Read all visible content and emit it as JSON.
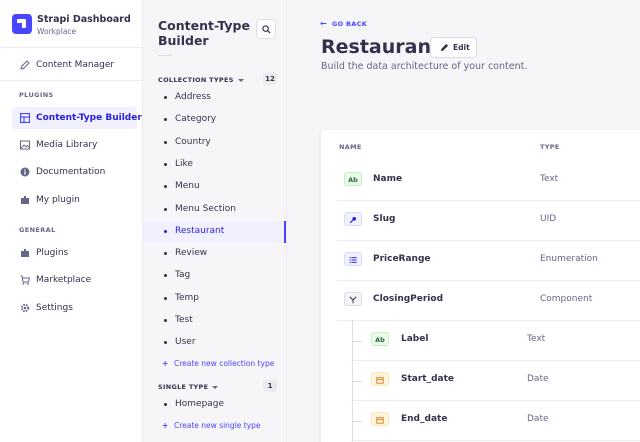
{
  "brand": {
    "title": "Strapi Dashboard",
    "subtitle": "Workplace"
  },
  "mainnav": {
    "content_manager": "Content Manager",
    "plugins_heading": "PLUGINS",
    "plugins": [
      {
        "label": "Content-Type Builder",
        "active": true
      },
      {
        "label": "Media Library"
      },
      {
        "label": "Documentation"
      },
      {
        "label": "My plugin"
      }
    ],
    "general_heading": "GENERAL",
    "general": [
      {
        "label": "Plugins"
      },
      {
        "label": "Marketplace"
      },
      {
        "label": "Settings"
      }
    ]
  },
  "subnav": {
    "title": "Content-Type Builder",
    "collection_heading": "COLLECTION TYPES",
    "collection_count": "12",
    "collection_types": [
      "Address",
      "Category",
      "Country",
      "Like",
      "Menu",
      "Menu Section",
      "Restaurant",
      "Review",
      "Tag",
      "Temp",
      "Test",
      "User"
    ],
    "active_collection": "Restaurant",
    "create_collection": "Create new collection type",
    "single_heading": "SINGLE TYPE",
    "single_count": "1",
    "single_types": [
      "Homepage"
    ],
    "create_single": "Create new single type"
  },
  "main": {
    "go_back": "GO BACK",
    "title": "Restaurant",
    "edit_label": "Edit",
    "subtitle": "Build the data architecture of your content.",
    "col_name": "NAME",
    "col_type": "TYPE",
    "fields": [
      {
        "badge": "Ab",
        "name": "Name",
        "type": "Text"
      },
      {
        "badge": "uid-icon",
        "name": "Slug",
        "type": "UID"
      },
      {
        "badge": "enum-icon",
        "name": "PriceRange",
        "type": "Enumeration"
      },
      {
        "badge": "component-icon",
        "name": "ClosingPeriod",
        "type": "Component"
      }
    ],
    "component_fields": [
      {
        "badge": "Ab",
        "name": "Label",
        "type": "Text"
      },
      {
        "badge": "date-icon",
        "name": "Start_date",
        "type": "Date"
      },
      {
        "badge": "date-icon",
        "name": "End_date",
        "type": "Date"
      }
    ]
  },
  "colors": {
    "primary": "#4945ff",
    "active_bg": "#f0f0ff",
    "text": "#32324d",
    "muted": "#666687"
  }
}
